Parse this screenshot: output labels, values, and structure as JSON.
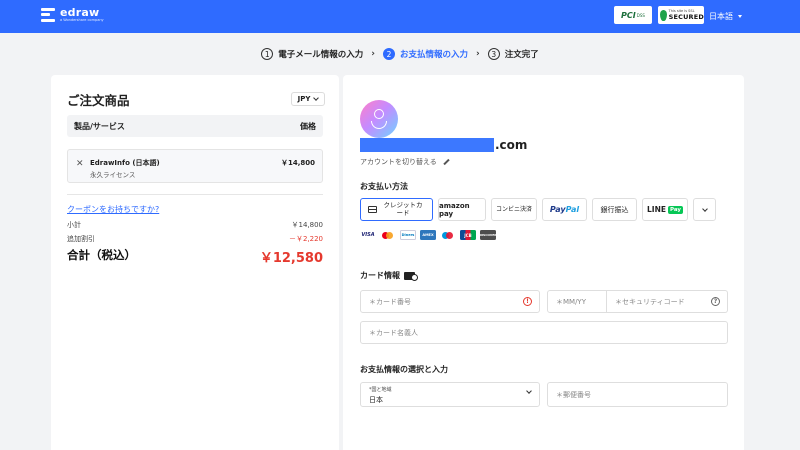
{
  "header": {
    "brand_name": "edraw",
    "brand_sub": "a Wondershare company",
    "pci_label": "PCI",
    "pci_sub": "DSS",
    "ssl_small": "This site is SSL",
    "ssl_big": "SECURED",
    "language": "日本語",
    "accent_color": "#2f6bff"
  },
  "steps": [
    {
      "num": "1",
      "label": "電子メール情報の入力"
    },
    {
      "num": "2",
      "label": "お支払情報の入力"
    },
    {
      "num": "3",
      "label": "注文完了"
    }
  ],
  "order": {
    "title": "ご注文商品",
    "currency": "JPY",
    "col_product": "製品/サービス",
    "col_price": "価格",
    "item_name": "EdrawInfo (日本語)",
    "item_license": "永久ライセンス",
    "item_price": "￥14,800",
    "coupon_link": "クーポンをお持ちですか?",
    "subtotal_label": "小計",
    "subtotal_value": "￥14,800",
    "discount_label": "追加割引",
    "discount_value": "－￥2,220",
    "total_label": "合計（税込）",
    "total_value": "￥12,580"
  },
  "payment": {
    "email_domain": ".com",
    "switch_account": "アカウントを切り替える",
    "method_title": "お支払い方法",
    "methods": {
      "credit": "クレジットカード",
      "amazon": "amazon pay",
      "konbini": "コンビニ決済",
      "paypal_a": "Pay",
      "paypal_b": "Pal",
      "bank": "銀行振込",
      "line": "LINE",
      "line_pay": "Pay"
    },
    "brands": {
      "visa": "VISA",
      "diners": "Diners",
      "amex": "AMEX",
      "jcb": "JCB",
      "discover": "DISCOVER"
    },
    "card_title": "カード情報",
    "card_number_placeholder": "＊カード番号",
    "expiry_placeholder": "＊MM/YY",
    "cvc_placeholder": "＊セキュリティコード",
    "card_name_placeholder": "＊カード名義人",
    "billing_title": "お支払情報の選択と入力",
    "country_label": "*国と地域",
    "country_value": "日本",
    "zip_placeholder": "＊郵便番号"
  }
}
